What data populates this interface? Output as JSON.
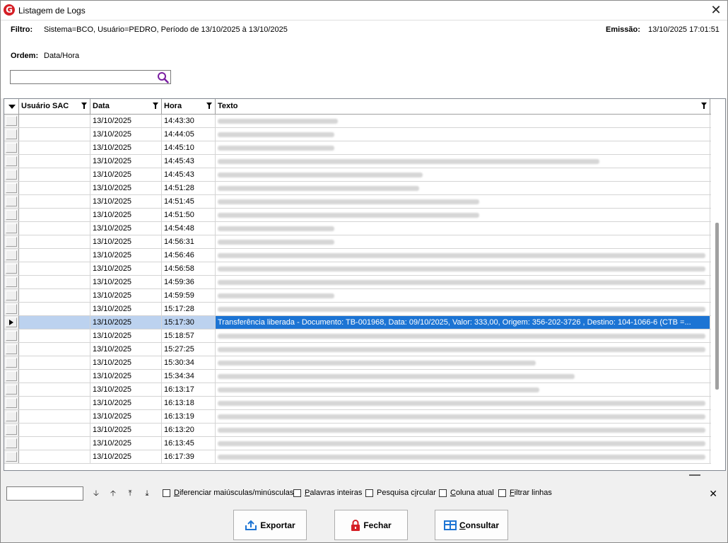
{
  "window": {
    "title": "Listagem de Logs",
    "close_glyph": "✕",
    "logo_letter": "G"
  },
  "header": {
    "filtro_label": "Filtro:",
    "filtro_value": "Sistema=BCO, Usuário=PEDRO, Período de 13/10/2025 à 13/10/2025",
    "emissao_label": "Emissão:",
    "emissao_value": "13/10/2025 17:01:51",
    "ordem_label": "Ordem:",
    "ordem_value": "Data/Hora",
    "search_value": ""
  },
  "grid": {
    "columns": [
      "Usuário SAC",
      "Data",
      "Hora",
      "Texto"
    ],
    "rows": [
      {
        "data": "13/10/2025",
        "hora": "14:43:30"
      },
      {
        "data": "13/10/2025",
        "hora": "14:44:05"
      },
      {
        "data": "13/10/2025",
        "hora": "14:45:10"
      },
      {
        "data": "13/10/2025",
        "hora": "14:45:43"
      },
      {
        "data": "13/10/2025",
        "hora": "14:45:43"
      },
      {
        "data": "13/10/2025",
        "hora": "14:51:28"
      },
      {
        "data": "13/10/2025",
        "hora": "14:51:45"
      },
      {
        "data": "13/10/2025",
        "hora": "14:51:50"
      },
      {
        "data": "13/10/2025",
        "hora": "14:54:48"
      },
      {
        "data": "13/10/2025",
        "hora": "14:56:31"
      },
      {
        "data": "13/10/2025",
        "hora": "14:56:46"
      },
      {
        "data": "13/10/2025",
        "hora": "14:56:58"
      },
      {
        "data": "13/10/2025",
        "hora": "14:59:36"
      },
      {
        "data": "13/10/2025",
        "hora": "14:59:59"
      },
      {
        "data": "13/10/2025",
        "hora": "15:17:28"
      },
      {
        "data": "13/10/2025",
        "hora": "15:17:30",
        "texto": "Transferência liberada - Documento: TB-001968, Data: 09/10/2025, Valor: 333,00, Origem: 356-202-3726      , Destino: 104-1066-6    (CTB =...",
        "selected": true
      },
      {
        "data": "13/10/2025",
        "hora": "15:18:57"
      },
      {
        "data": "13/10/2025",
        "hora": "15:27:25"
      },
      {
        "data": "13/10/2025",
        "hora": "15:30:34"
      },
      {
        "data": "13/10/2025",
        "hora": "15:34:34"
      },
      {
        "data": "13/10/2025",
        "hora": "16:13:17"
      },
      {
        "data": "13/10/2025",
        "hora": "16:13:18"
      },
      {
        "data": "13/10/2025",
        "hora": "16:13:19"
      },
      {
        "data": "13/10/2025",
        "hora": "16:13:20"
      },
      {
        "data": "13/10/2025",
        "hora": "16:13:45"
      },
      {
        "data": "13/10/2025",
        "hora": "16:17:39"
      }
    ]
  },
  "findbar": {
    "value": "",
    "options": [
      {
        "pre": "",
        "ul": "D",
        "post": "iferenciar maiúsculas/minúsculas"
      },
      {
        "pre": "",
        "ul": "P",
        "post": "alavras inteiras"
      },
      {
        "pre": "Pesquisa c",
        "ul": "i",
        "post": "rcular"
      },
      {
        "pre": "",
        "ul": "C",
        "post": "oluna atual"
      },
      {
        "pre": "",
        "ul": "F",
        "post": "iltrar linhas"
      }
    ],
    "close_glyph": "✕"
  },
  "buttons": {
    "exportar": "Exportar",
    "fechar": "Fechar",
    "consultar_ul": "C",
    "consultar_rest": "onsultar"
  },
  "colors": {
    "selection": "#1c74d4",
    "selection_light": "#bcd2ef",
    "logo": "#d51f26",
    "search_icon": "#7b1fa2"
  }
}
